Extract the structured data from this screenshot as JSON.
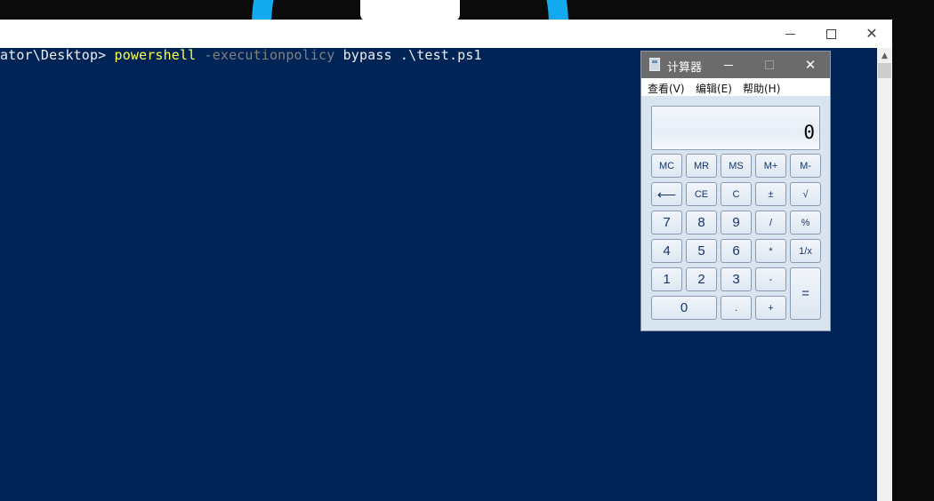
{
  "powershell": {
    "controls": {
      "minimize": "—",
      "maximize": "☐",
      "close": "✕"
    },
    "console": {
      "prompt": "ator\\Desktop> ",
      "command": "powershell",
      "parameter": "-executionpolicy",
      "arguments": "bypass .\\test.ps1"
    },
    "colors": {
      "background": "#012456",
      "command": "#fdfd54",
      "parameter": "#808080",
      "text": "#eeedf0"
    }
  },
  "calculator": {
    "title": "计算器",
    "menu": {
      "view": "查看(V)",
      "edit": "编辑(E)",
      "help": "帮助(H)"
    },
    "display": "0",
    "buttons": {
      "mc": "MC",
      "mr": "MR",
      "ms": "MS",
      "m_plus": "M+",
      "m_minus": "M-",
      "backspace": "⟵",
      "ce": "CE",
      "c": "C",
      "plus_minus": "±",
      "sqrt": "√",
      "d7": "7",
      "d8": "8",
      "d9": "9",
      "divide": "/",
      "percent": "%",
      "d4": "4",
      "d5": "5",
      "d6": "6",
      "multiply": "*",
      "reciprocal": "1/x",
      "d1": "1",
      "d2": "2",
      "d3": "3",
      "minus": "-",
      "equals": "=",
      "d0": "0",
      "decimal": ".",
      "plus": "+"
    }
  }
}
